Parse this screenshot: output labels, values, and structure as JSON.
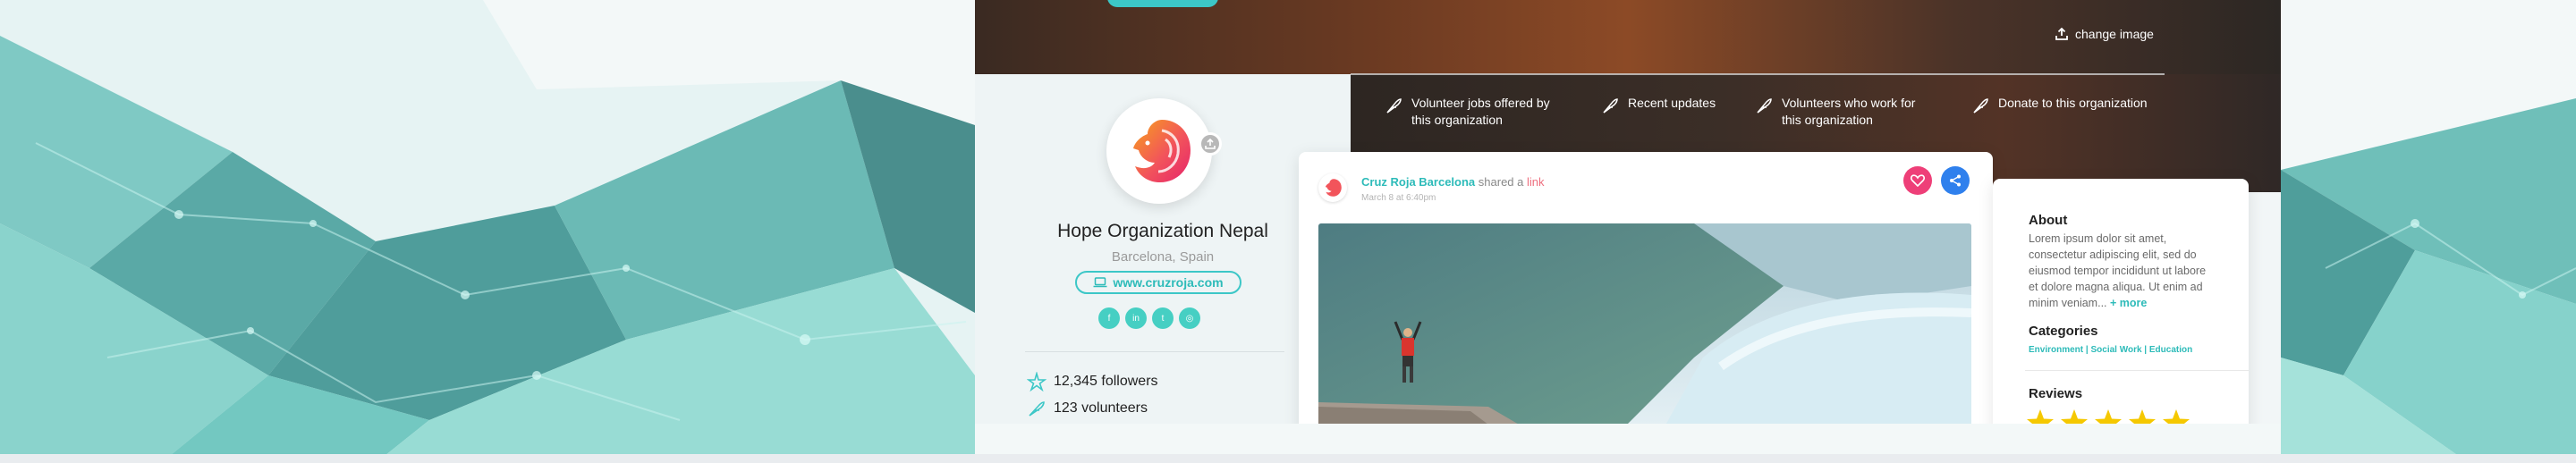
{
  "hero": {
    "change_image_label": "change image"
  },
  "nav": {
    "items": [
      {
        "label": "Volunteer jobs offered by this organization",
        "icon": "feather-icon"
      },
      {
        "label": "Recent updates",
        "icon": "feather-icon"
      },
      {
        "label": "Volunteers who work for this organization",
        "icon": "feather-icon"
      },
      {
        "label": "Donate to this organization",
        "icon": "feather-icon"
      }
    ]
  },
  "profile": {
    "name": "Hope Organization Nepal",
    "location": "Barcelona, Spain",
    "website": "www.cruzroja.com",
    "socials": [
      "f",
      "in",
      "t",
      "◎"
    ],
    "stats": [
      {
        "label": "12,345 followers",
        "icon": "star-burst-icon"
      },
      {
        "label": "123 volunteers",
        "icon": "feather-icon"
      }
    ]
  },
  "post": {
    "author": "Cruz Roja Barcelona",
    "shared_text": "shared a",
    "link_text": "link",
    "date": "March 8 at 6:40pm"
  },
  "sidebar": {
    "about_title": "About",
    "about_text": "Lorem ipsum dolor sit amet, consectetur adipiscing elit, sed do eiusmod tempor incididunt ut labore et dolore magna aliqua. Ut enim ad minim veniam...",
    "more_label": "+ more",
    "categories_title": "Categories",
    "categories": "Environment | Social Work | Education",
    "reviews_title": "Reviews",
    "rating": 5
  },
  "colors": {
    "accent": "#3cc7c7",
    "like": "#ee3f78",
    "share": "#2f80ed",
    "star": "#f5c800"
  }
}
